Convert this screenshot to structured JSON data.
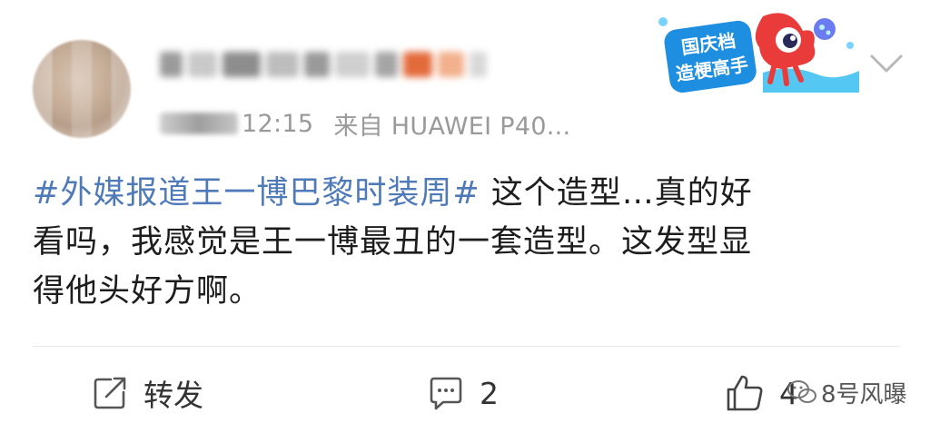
{
  "post": {
    "time": "12:15",
    "source": "来自 HUAWEI P40...",
    "hashtag": "#外媒报道王一博巴黎时装周#",
    "body_line1": " 这个造型…真的好",
    "body_line2": "看吗，我感觉是王一博最丑的一套造型。这发型显",
    "body_line3": "得他头好方啊。"
  },
  "badge": {
    "line1": "国庆档",
    "line2": "造梗高手"
  },
  "actions": {
    "repost_label": "转发",
    "comment_count": "2",
    "like_count": "4"
  },
  "watermark": {
    "text": "8号风曝"
  },
  "colors": {
    "hashtag": "#4f7ab9",
    "meta": "#9a9a9a",
    "badge_text": "#ffffff"
  }
}
